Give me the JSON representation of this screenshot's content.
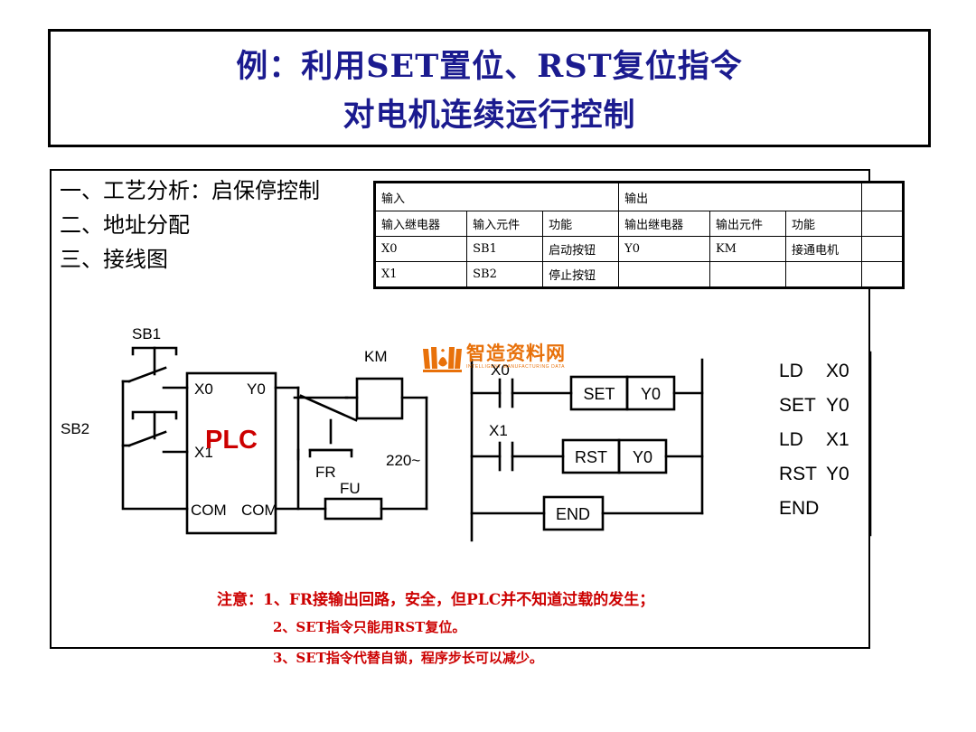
{
  "title": {
    "line1": "例：利用SET置位、RST复位指令",
    "line2": "对电机连续运行控制"
  },
  "outline": {
    "items": [
      "一、工艺分析：启保停控制",
      "二、地址分配",
      "三、接线图"
    ]
  },
  "io_table": {
    "group_headers": {
      "input": "输入",
      "output": "输出"
    },
    "columns": [
      "输入继电器",
      "输入元件",
      "功能",
      "输出继电器",
      "输出元件",
      "功能",
      ""
    ],
    "rows": [
      [
        "X0",
        "SB1",
        "启动按钮",
        "Y0",
        "KM",
        "接通电机",
        ""
      ],
      [
        "X1",
        "SB2",
        "停止按钮",
        "",
        "",
        "",
        ""
      ]
    ]
  },
  "schematic": {
    "labels": {
      "sb1": "SB1",
      "sb2": "SB2",
      "plc": "PLC",
      "x0": "X0",
      "x1": "X1",
      "y0": "Y0",
      "com_left": "COM",
      "com_right": "COM",
      "km": "KM",
      "fr": "FR",
      "fu": "FU",
      "supply": "220~"
    },
    "plc_color": "#cc0000"
  },
  "ladder": {
    "rungs": [
      {
        "contact": "X0",
        "box1": "SET",
        "box2": "Y0"
      },
      {
        "contact": "X1",
        "box1": "RST",
        "box2": "Y0"
      },
      {
        "contact": "",
        "box1": "END",
        "box2": ""
      }
    ]
  },
  "watermark": {
    "text": "智造资料网",
    "subtitle": "INTELLIGENT MANUFACTURING DATA",
    "color": "#e8710a"
  },
  "instructions": {
    "lines": [
      {
        "op": "LD",
        "operand": "X0"
      },
      {
        "op": "SET",
        "operand": "Y0"
      },
      {
        "op": "LD",
        "operand": "X1"
      },
      {
        "op": "RST",
        "operand": "Y0"
      },
      {
        "op": "END",
        "operand": ""
      }
    ]
  },
  "notes": {
    "label": "注意：",
    "line1": "1、FR接输出回路，安全，但PLC并不知道过载的发生；",
    "line2": "2、SET指令只能用RST复位。",
    "line3": "3、SET指令代替自锁，程序步长可以减少。",
    "color": "#cc0000"
  }
}
